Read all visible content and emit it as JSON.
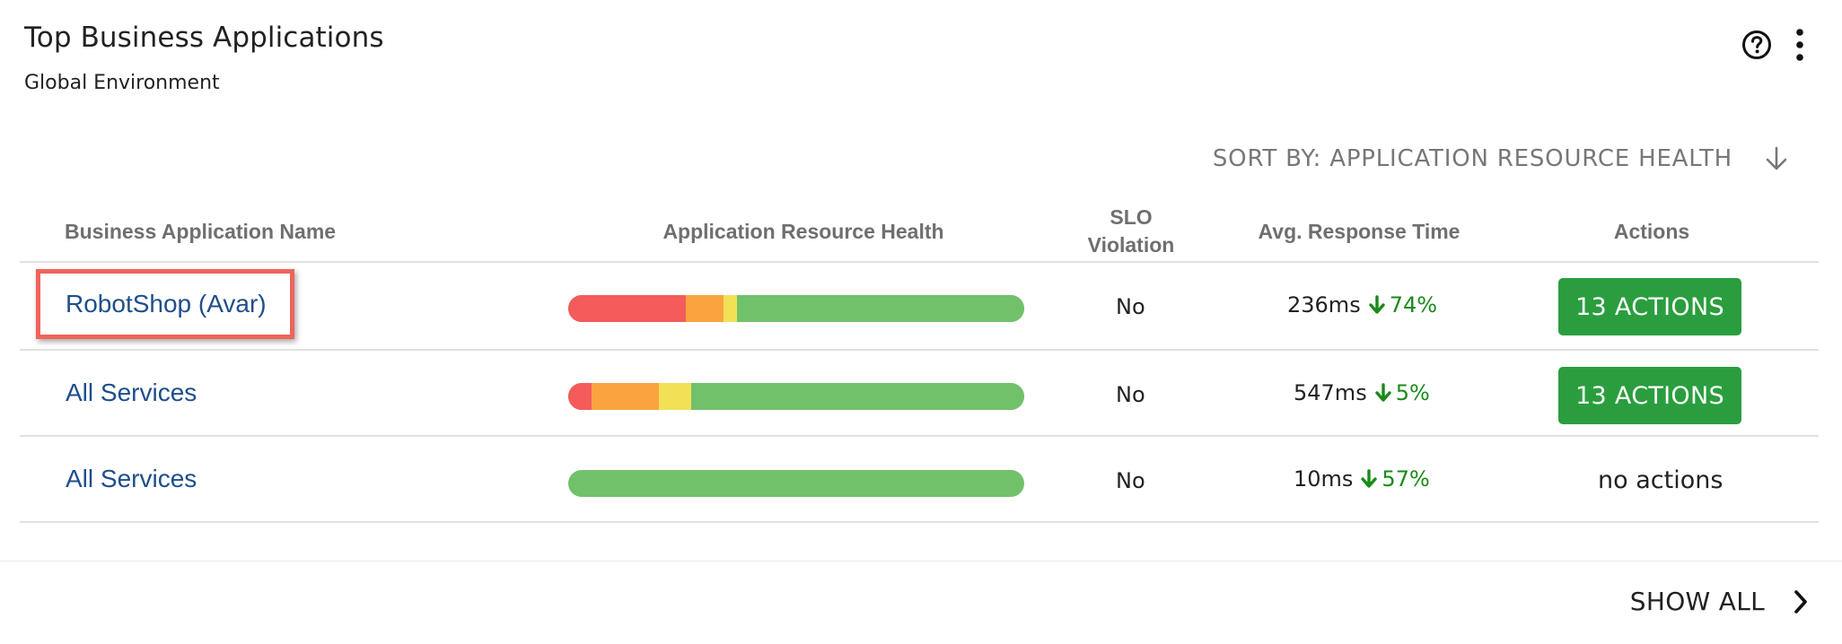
{
  "header": {
    "title": "Top Business Applications",
    "subtitle": "Global Environment"
  },
  "toolbar": {
    "help_icon": "help-circle-icon",
    "more_icon": "more-vertical-icon"
  },
  "sort": {
    "label": "SORT BY: APPLICATION RESOURCE HEALTH",
    "direction_icon": "arrow-down-icon"
  },
  "table": {
    "columns": {
      "name": "Business Application Name",
      "health": "Application Resource Health",
      "slo_line1": "SLO",
      "slo_line2": "Violation",
      "response": "Avg. Response Time",
      "actions": "Actions"
    },
    "rows": [
      {
        "name": "RobotShop (Avar)",
        "highlighted": true,
        "health": {
          "red": 0.258,
          "orange": 0.082,
          "yellow": 0.03,
          "green": 0.63
        },
        "slo_violation": "No",
        "response_ms": "236ms",
        "response_change": "74%",
        "actions": "13 ACTIONS"
      },
      {
        "name": "All Services",
        "highlighted": false,
        "health": {
          "red": 0.052,
          "orange": 0.147,
          "yellow": 0.07,
          "green": 0.731
        },
        "slo_violation": "No",
        "response_ms": "547ms",
        "response_change": "5%",
        "actions": "13 ACTIONS"
      },
      {
        "name": "All Services",
        "highlighted": false,
        "health": {
          "red": 0,
          "orange": 0,
          "yellow": 0,
          "green": 1
        },
        "slo_violation": "No",
        "response_ms": "10ms",
        "response_change": "57%",
        "actions": "no actions"
      }
    ]
  },
  "footer": {
    "show_all": "SHOW ALL",
    "chevron_icon": "chevron-right-icon"
  },
  "colors": {
    "link": "#1f4e8c",
    "health_red": "#f45b5b",
    "health_orange": "#fba43f",
    "health_yellow": "#f2e157",
    "health_green": "#71c16a",
    "action_green": "#2a9e3e",
    "trend_green": "#1a8a1a",
    "highlight": "#f0645a"
  }
}
